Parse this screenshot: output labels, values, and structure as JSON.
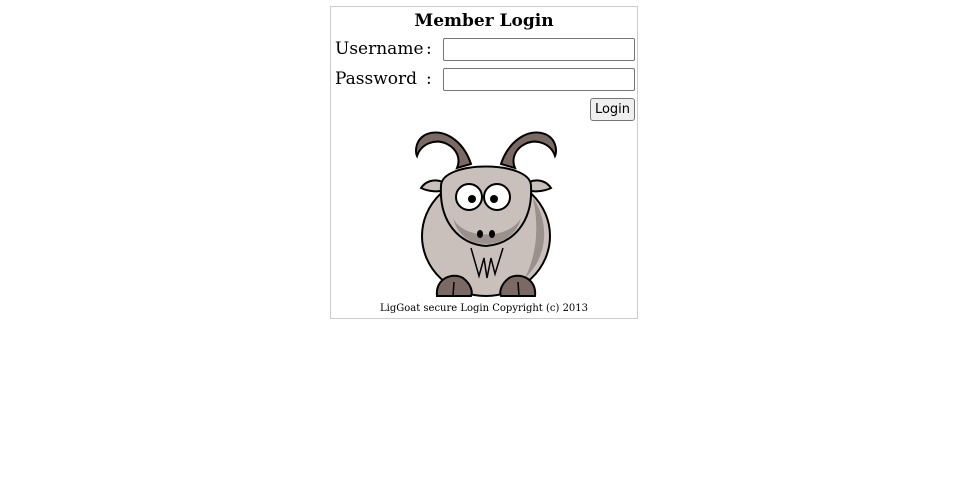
{
  "login": {
    "title": "Member Login",
    "username_label": "Username",
    "password_label": "Password",
    "colon": ":",
    "username_value": "",
    "password_value": "",
    "login_button": "Login",
    "footer": "LigGoat secure Login Copyright (c) 2013"
  },
  "logo": {
    "icon": "goat-mascot-icon",
    "colors": {
      "body": "#c9c0bb",
      "shade": "#9a918c",
      "horn": "#7a6a63",
      "hoof": "#7a6a63",
      "outline": "#000000"
    }
  }
}
